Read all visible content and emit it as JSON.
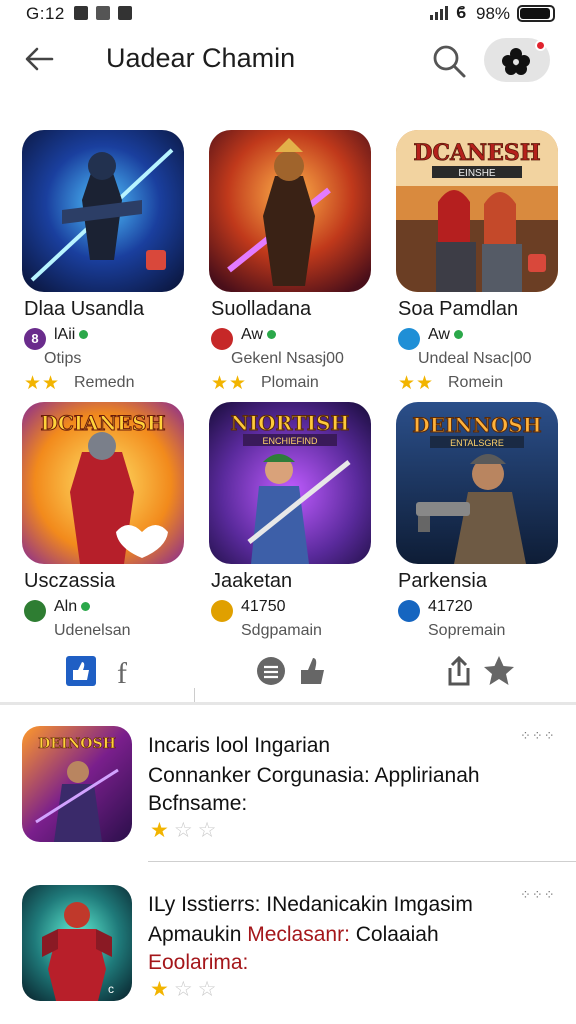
{
  "status_bar": {
    "time": "G:12",
    "battery_pct": "98%"
  },
  "header": {
    "title": "Uadear Chamin"
  },
  "grid": [
    {
      "title": "Dlaa Usandla",
      "dev": "lAii",
      "meta": "Otips",
      "rating": "Remedn",
      "dev_icon_color": "#6a2c8c",
      "dev_icon_glyph": "8"
    },
    {
      "title": "Suolladana",
      "dev": "Aw",
      "meta": "Gekenl Nsasj00",
      "rating": "Plomain",
      "dev_icon_color": "#c62828",
      "dev_icon_glyph": ""
    },
    {
      "title": "Soa Pamdlan",
      "dev": "Aw",
      "meta": "Undeal Nsac|00",
      "rating": "Romein",
      "dev_icon_color": "#1f8fd6",
      "dev_icon_glyph": ""
    },
    {
      "title": "Usczassia",
      "dev": "Aln",
      "meta": "Udenelsan",
      "rating": "",
      "dev_icon_color": "#2e7d32",
      "dev_icon_glyph": ""
    },
    {
      "title": "Jaaketan",
      "dev": "41750",
      "meta": "Sdgpamain",
      "rating": "",
      "dev_icon_color": "#e0a000",
      "dev_icon_glyph": ""
    },
    {
      "title": "Parkensia",
      "dev": "41720",
      "meta": "Sopremain",
      "rating": "",
      "dev_icon_color": "#1565c0",
      "dev_icon_glyph": ""
    }
  ],
  "thumb_text": {
    "t3_line1": "DCANESH",
    "t3_line2": "EINSHE",
    "t4_line1": "DCIANESH",
    "t5_line1": "NIORTISH",
    "t5_line2": "ENCHIEFIND",
    "t6_line1": "DEINNOSH",
    "t6_line2": "ENTALSGRE",
    "l1_line1": "DEINOSH"
  },
  "list": [
    {
      "line1": "Incaris lool Ingarian",
      "line2": "Connanker Corgunasia: Applirianah",
      "line3": "Bcfnsame:",
      "line3_accent": false,
      "stars_on": 1,
      "stars_total": 3,
      "more": "⁘⁘⁘"
    },
    {
      "line1": "ILy Isstierrs: INedanicakin Imgasim",
      "line2_a": "Apmaukin ",
      "line2_b": "Meclasanr:",
      "line2_c": " Colaaiah",
      "line3": "Eoolarima:",
      "line3_accent": true,
      "stars_on": 1,
      "stars_total": 3,
      "more": "⁘⁘⁘"
    }
  ],
  "colors": {
    "star": "#f2b400",
    "accent": "#a4161a",
    "online": "#2ba84a",
    "notification": "#e0232e"
  }
}
